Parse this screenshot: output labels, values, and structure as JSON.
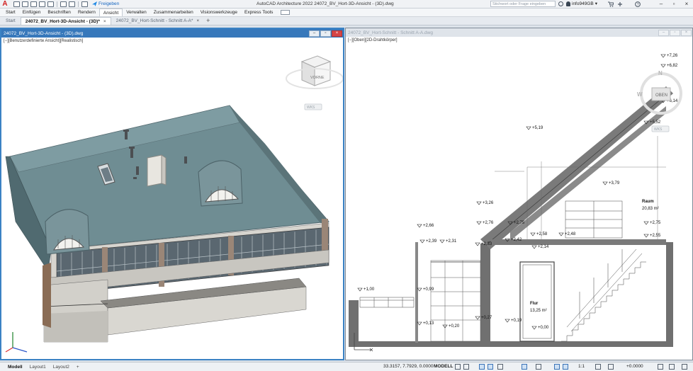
{
  "title_bar": {
    "app_letter": "A",
    "share_label": "Freigeben",
    "window_title": "AutoCAD Architecture 2022    24072_BV_Hort-3D-Ansicht - (3D).dwg",
    "search_placeholder": "Stichwort oder Frage eingeben",
    "user_name": "info949GB"
  },
  "ribbon_tabs": [
    "Start",
    "Einfügen",
    "Beschriften",
    "Rendern",
    "Ansicht",
    "Verwalten",
    "Zusammenarbeiten",
    "Visionswerkzeuge",
    "Express Tools"
  ],
  "ribbon_active": "Ansicht",
  "file_tabs": [
    {
      "label": "Start",
      "closable": false
    },
    {
      "label": "24072_BV_Hort-3D-Ansicht - (3D)*",
      "closable": true
    },
    {
      "label": "24072_BV_Hort-Schnitt - Schnitt A-A*",
      "closable": true
    }
  ],
  "viewport_left": {
    "title": "24072_BV_Hort-3D-Ansicht - (3D).dwg",
    "label": "[−][Benutzerdefinierte Ansicht][Realistisch]",
    "viewcube_face": "VORNE",
    "ucs_label": "WKS"
  },
  "viewport_right": {
    "title": "24072_BV_Hort-Schnitt - Schnitt A-A.dwg",
    "label": "[−][Oben][2D-Drahtkörper]",
    "viewcube_face": "OBEN",
    "compass": {
      "n": "N",
      "w": "W"
    },
    "ucs_label": "WKS",
    "rooms": [
      {
        "name": "Raum",
        "area": "20,83 m²"
      },
      {
        "name": "Flur",
        "area": "13,25 m²"
      }
    ],
    "levels": [
      "+7,26",
      "+6,82",
      "+6,14",
      "+5,52",
      "+5,19",
      "+3,79",
      "+3,26",
      "+2,66",
      "+2,76",
      "+2,75",
      "+2,75",
      "+2,55",
      "+2,58",
      "+2,48",
      "+2,39",
      "+2,31",
      "+2,33",
      "+2,42",
      "+2,14",
      "+1,00",
      "+0,99",
      "+0,27",
      "+0,19",
      "+0,13",
      "+0,20",
      "+0,00"
    ]
  },
  "layout_tabs": [
    "Modell",
    "Layout1",
    "Layout2"
  ],
  "layout_active": "Modell",
  "status_bar": {
    "coordinates": "33.3157, 7.7929, 0.0000",
    "mode": "MODELL",
    "scale": "1:1",
    "elevation": "+0.0000"
  }
}
